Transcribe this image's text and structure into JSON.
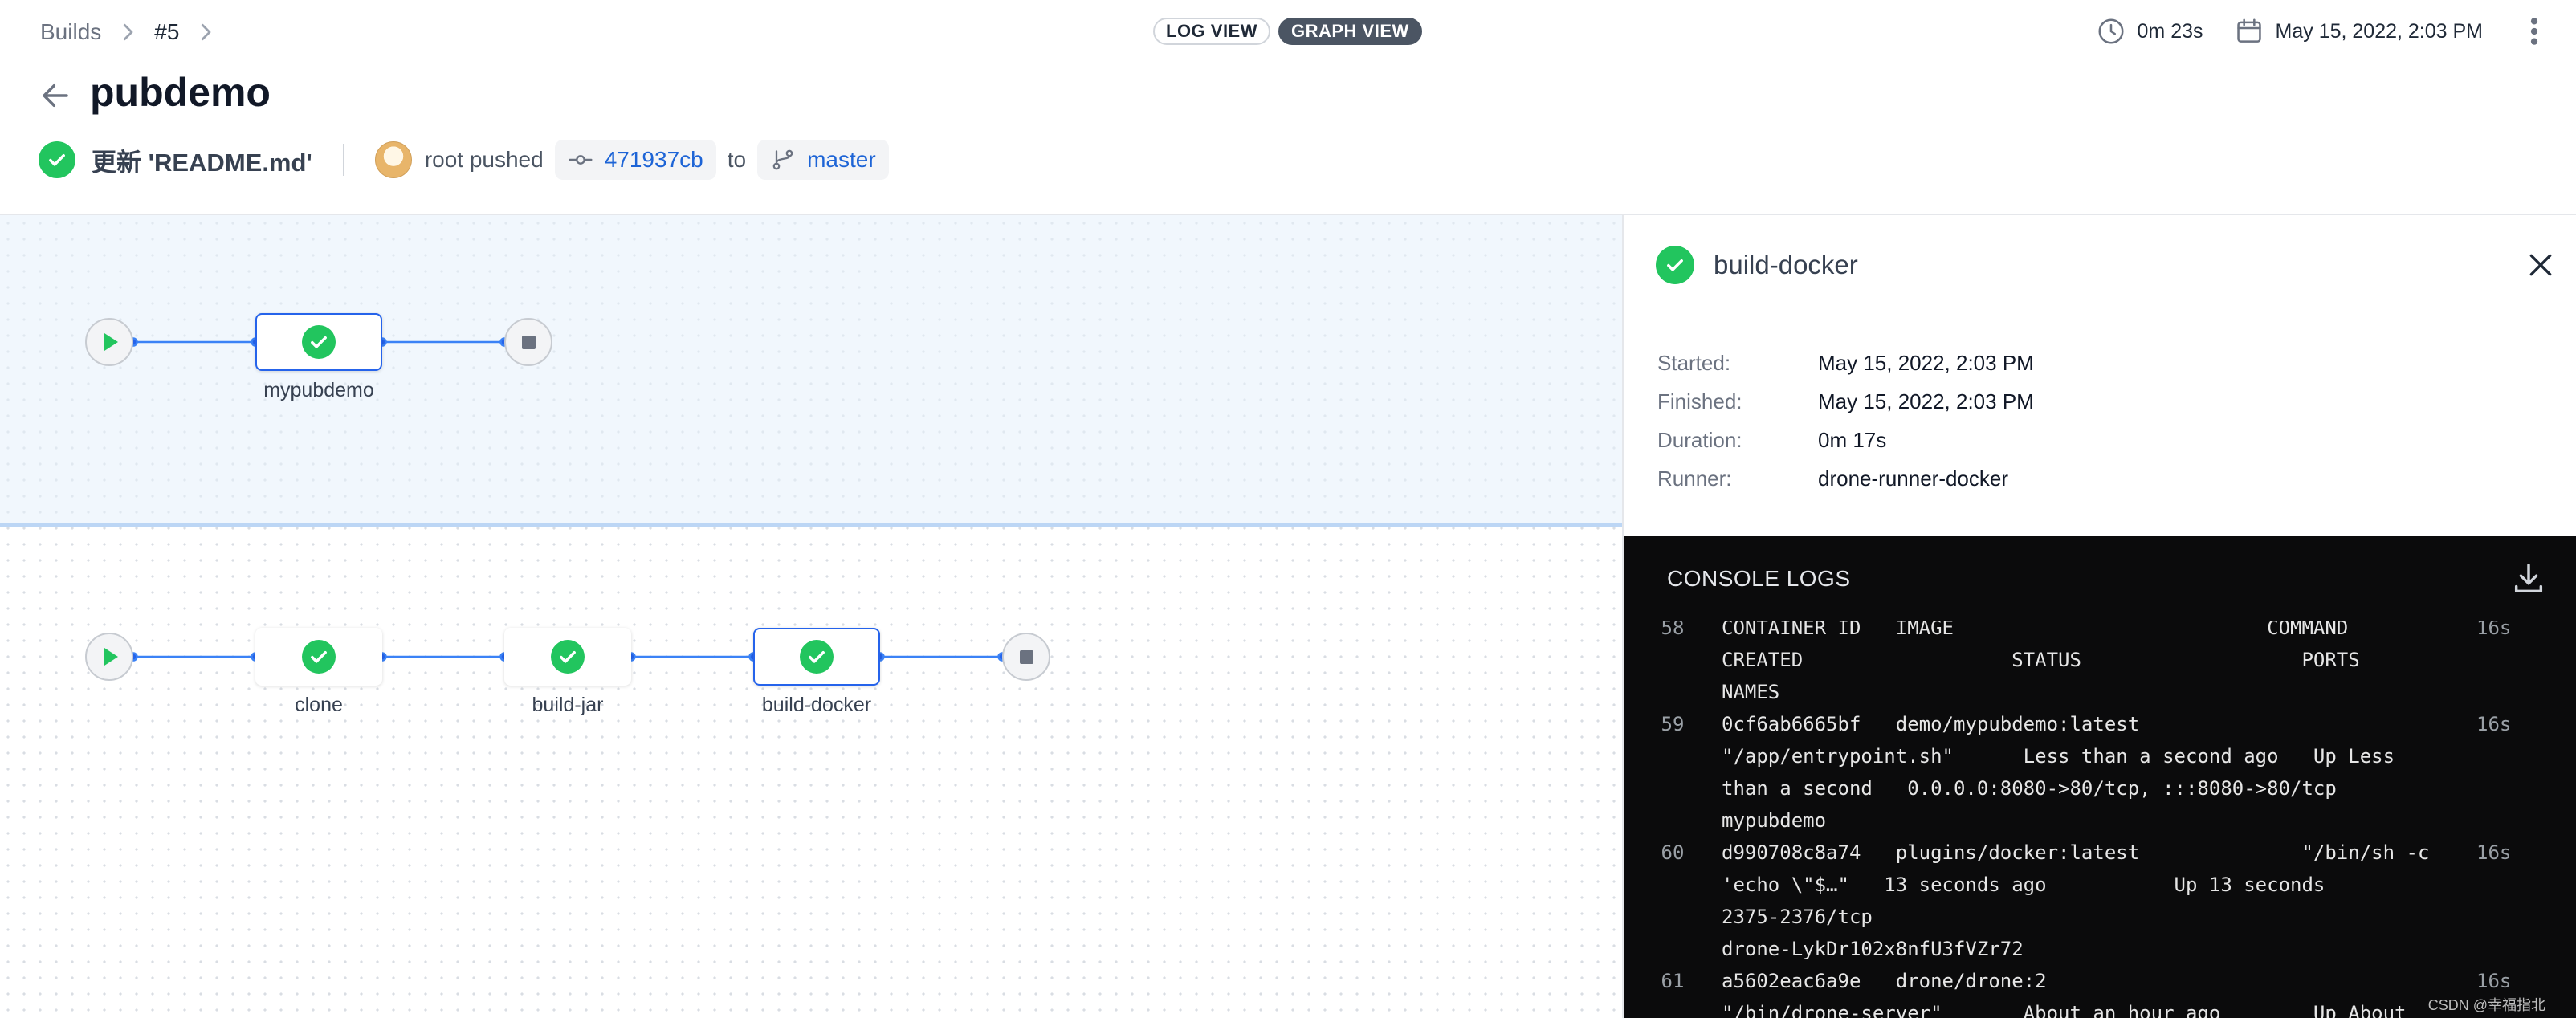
{
  "breadcrumb": {
    "builds": "Builds",
    "build_number": "#5"
  },
  "view_toggle": {
    "log_view": "LOG VIEW",
    "graph_view": "GRAPH VIEW",
    "active": "graph_view"
  },
  "meta": {
    "duration": "0m 23s",
    "date": "May 15, 2022, 2:03 PM"
  },
  "repo": {
    "title": "pubdemo"
  },
  "commit": {
    "message": "更新 'README.md'",
    "author_action": "root pushed",
    "sha": "471937cb",
    "to_label": "to",
    "branch": "master"
  },
  "graph": {
    "stages": [
      {
        "nodes": [
          {
            "label": "mypubdemo",
            "status": "success",
            "selected": true
          }
        ]
      },
      {
        "nodes": [
          {
            "label": "clone",
            "status": "success",
            "selected": false
          },
          {
            "label": "build-jar",
            "status": "success",
            "selected": false
          },
          {
            "label": "build-docker",
            "status": "success",
            "selected": true
          }
        ]
      }
    ]
  },
  "panel": {
    "step_name": "build-docker",
    "started_label": "Started:",
    "started": "May 15, 2022, 2:03 PM",
    "finished_label": "Finished:",
    "finished": "May 15, 2022, 2:03 PM",
    "duration_label": "Duration:",
    "duration": "0m 17s",
    "runner_label": "Runner:",
    "runner": "drone-runner-docker"
  },
  "console": {
    "title": "CONSOLE LOGS",
    "lines": [
      {
        "num": "58",
        "text": "CONTAINER ID   IMAGE                           COMMAND\nCREATED                  STATUS                   PORTS\nNAMES",
        "time": "16s"
      },
      {
        "num": "59",
        "text": "0cf6ab6665bf   demo/mypubdemo:latest\n\"/app/entrypoint.sh\"      Less than a second ago   Up Less\nthan a second   0.0.0.0:8080->80/tcp, :::8080->80/tcp\nmypubdemo",
        "time": "16s"
      },
      {
        "num": "60",
        "text": "d990708c8a74   plugins/docker:latest              \"/bin/sh -c\n'echo \\\"$…\"   13 seconds ago           Up 13 seconds\n2375-2376/tcp\ndrone-LykDr102x8nfU3fVZr72",
        "time": "16s"
      },
      {
        "num": "61",
        "text": "a5602eac6a9e   drone/drone:2\n\"/bin/drone-server\"       About an hour ago        Up About",
        "time": "16s"
      }
    ]
  },
  "watermark": "CSDN @幸福指北",
  "colors": {
    "success": "#22c55e",
    "link": "#1d64d6",
    "edge": "#2563eb",
    "console_bg": "#0b0b0c"
  }
}
